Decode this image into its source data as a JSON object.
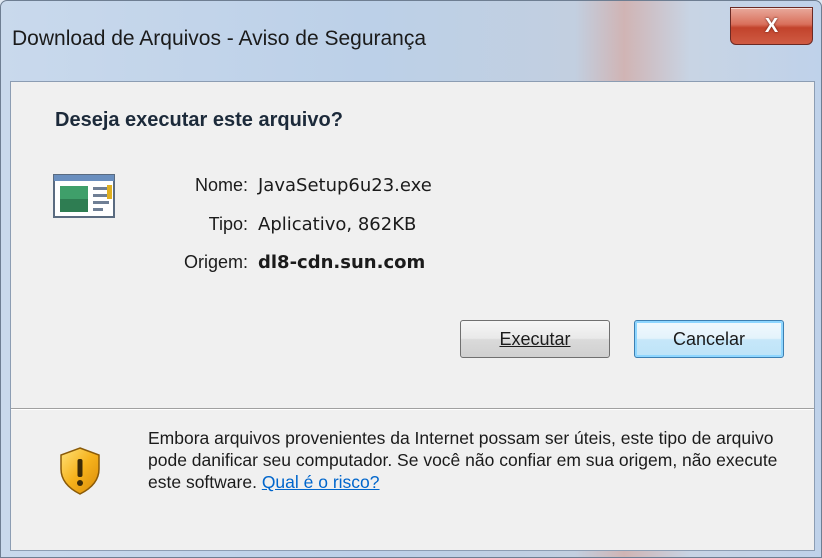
{
  "window": {
    "title": "Download de Arquivos - Aviso de Segurança",
    "close_label": "X"
  },
  "dialog": {
    "question": "Deseja executar este arquivo?",
    "file_info": {
      "name_label": "Nome:",
      "name_value": "JavaSetup6u23.exe",
      "type_label": "Tipo:",
      "type_value": "Aplicativo, 862KB",
      "origin_label": "Origem:",
      "origin_value": "dl8-cdn.sun.com"
    },
    "buttons": {
      "run_label": "Executar",
      "cancel_label": "Cancelar"
    },
    "warning": {
      "text": "Embora arquivos provenientes da Internet possam ser úteis, este tipo de arquivo pode danificar seu computador. Se você não confiar em sua origem, não execute este software. ",
      "link_label": "Qual é o risco?"
    }
  },
  "icons": {
    "file": "application-file-icon",
    "warning": "security-shield-icon",
    "close": "close-icon"
  },
  "colors": {
    "close_button": "#c8452e",
    "link": "#0066cc",
    "default_button_border": "#3c7fb1",
    "shield": "#f0a818"
  }
}
